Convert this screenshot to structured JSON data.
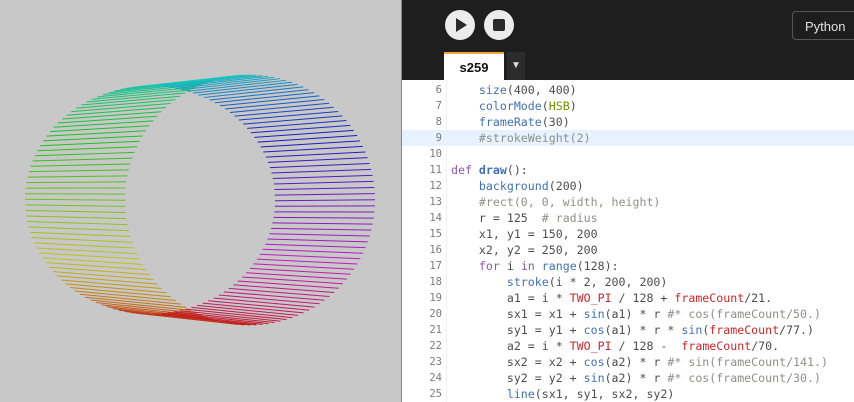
{
  "toolbar": {
    "play_icon": "play-icon",
    "stop_icon": "stop-icon",
    "language": "Python"
  },
  "tabs": [
    {
      "label": "s259",
      "active": true
    }
  ],
  "tab_dropdown_glyph": "▼",
  "editor": {
    "highlighted_line": 9,
    "lines": [
      {
        "num": "6",
        "tokens": [
          [
            "n",
            "    "
          ],
          [
            "b",
            "size"
          ],
          [
            "n",
            "(400, 400)"
          ]
        ]
      },
      {
        "num": "7",
        "tokens": [
          [
            "n",
            "    "
          ],
          [
            "b",
            "colorMode"
          ],
          [
            "n",
            "("
          ],
          [
            "s",
            "HSB"
          ],
          [
            "n",
            ")"
          ]
        ]
      },
      {
        "num": "8",
        "tokens": [
          [
            "n",
            "    "
          ],
          [
            "b",
            "frameRate"
          ],
          [
            "n",
            "(30)"
          ]
        ]
      },
      {
        "num": "9",
        "tokens": [
          [
            "c",
            "    #strokeWeight(2)"
          ]
        ]
      },
      {
        "num": "10",
        "tokens": []
      },
      {
        "num": "11",
        "tokens": [
          [
            "def",
            "def "
          ],
          [
            "f",
            "draw"
          ],
          [
            "n",
            "():"
          ]
        ]
      },
      {
        "num": "12",
        "tokens": [
          [
            "n",
            "    "
          ],
          [
            "b",
            "background"
          ],
          [
            "n",
            "(200)"
          ]
        ]
      },
      {
        "num": "13",
        "tokens": [
          [
            "c",
            "    #rect(0, 0, width, height)"
          ]
        ]
      },
      {
        "num": "14",
        "tokens": [
          [
            "n",
            "    r = 125  "
          ],
          [
            "c",
            "# radius"
          ]
        ]
      },
      {
        "num": "15",
        "tokens": [
          [
            "n",
            "    x1, y1 = 150, 200"
          ]
        ]
      },
      {
        "num": "16",
        "tokens": [
          [
            "n",
            "    x2, y2 = 250, 200"
          ]
        ]
      },
      {
        "num": "17",
        "tokens": [
          [
            "n",
            "    "
          ],
          [
            "k",
            "for"
          ],
          [
            "n",
            " i "
          ],
          [
            "k",
            "in"
          ],
          [
            "n",
            " "
          ],
          [
            "b",
            "range"
          ],
          [
            "n",
            "(128):"
          ]
        ]
      },
      {
        "num": "18",
        "tokens": [
          [
            "n",
            "        "
          ],
          [
            "b",
            "stroke"
          ],
          [
            "n",
            "(i * 2, 200, 200)"
          ]
        ]
      },
      {
        "num": "19",
        "tokens": [
          [
            "n",
            "        a1 = i * "
          ],
          [
            "m",
            "TWO_PI"
          ],
          [
            "n",
            " / 128 + "
          ],
          [
            "m",
            "frameCount"
          ],
          [
            "n",
            "/21."
          ]
        ]
      },
      {
        "num": "20",
        "tokens": [
          [
            "n",
            "        sx1 = x1 + "
          ],
          [
            "b",
            "sin"
          ],
          [
            "n",
            "(a1) * r "
          ],
          [
            "c",
            "#* cos(frameCount/50.)"
          ]
        ]
      },
      {
        "num": "21",
        "tokens": [
          [
            "n",
            "        sy1 = y1 + "
          ],
          [
            "b",
            "cos"
          ],
          [
            "n",
            "(a1) * r * "
          ],
          [
            "b",
            "sin"
          ],
          [
            "n",
            "("
          ],
          [
            "m",
            "frameCount"
          ],
          [
            "n",
            "/77.)"
          ]
        ]
      },
      {
        "num": "22",
        "tokens": [
          [
            "n",
            "        a2 = i * "
          ],
          [
            "m",
            "TWO_PI"
          ],
          [
            "n",
            " / 128 -  "
          ],
          [
            "m",
            "frameCount"
          ],
          [
            "n",
            "/70."
          ]
        ]
      },
      {
        "num": "23",
        "tokens": [
          [
            "n",
            "        sx2 = x2 + "
          ],
          [
            "b",
            "cos"
          ],
          [
            "n",
            "(a2) * r "
          ],
          [
            "c",
            "#* sin(frameCount/141.)"
          ]
        ]
      },
      {
        "num": "24",
        "tokens": [
          [
            "n",
            "        sy2 = y2 + "
          ],
          [
            "b",
            "sin"
          ],
          [
            "n",
            "(a2) * r "
          ],
          [
            "c",
            "#* cos(frameCount/30.)"
          ]
        ]
      },
      {
        "num": "25",
        "tokens": [
          [
            "n",
            "        "
          ],
          [
            "b",
            "line"
          ],
          [
            "n",
            "(sx1, sy1, sx2, sy2)"
          ]
        ]
      }
    ]
  },
  "sketch": {
    "background": "#c8c8c8",
    "line_count": 128,
    "hue_step": 2,
    "saturation": 200,
    "brightness": 200
  }
}
